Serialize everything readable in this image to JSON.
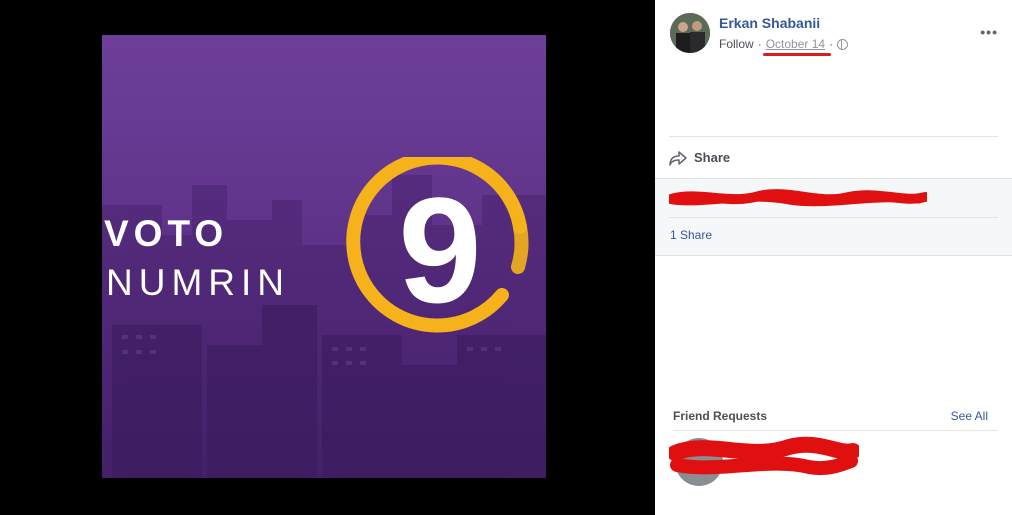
{
  "poster": {
    "line1": "VOTO",
    "line2": "NUMRIN",
    "number": "9",
    "colors": {
      "background": "#62358c",
      "ring": "#f5b21b",
      "text": "#ffffff"
    }
  },
  "post": {
    "author": "Erkan Shabanii",
    "follow_label": "Follow",
    "separator": "·",
    "date": "October 14",
    "more_label": "•••",
    "share_label": "Share",
    "shares_count": "1 Share"
  },
  "friend_requests": {
    "title": "Friend Requests",
    "see_all": "See All"
  },
  "icons": [
    "globe-icon",
    "share-arrow-icon",
    "more-options-icon"
  ],
  "colors": {
    "link": "#365899",
    "redaction": "#e01010"
  }
}
